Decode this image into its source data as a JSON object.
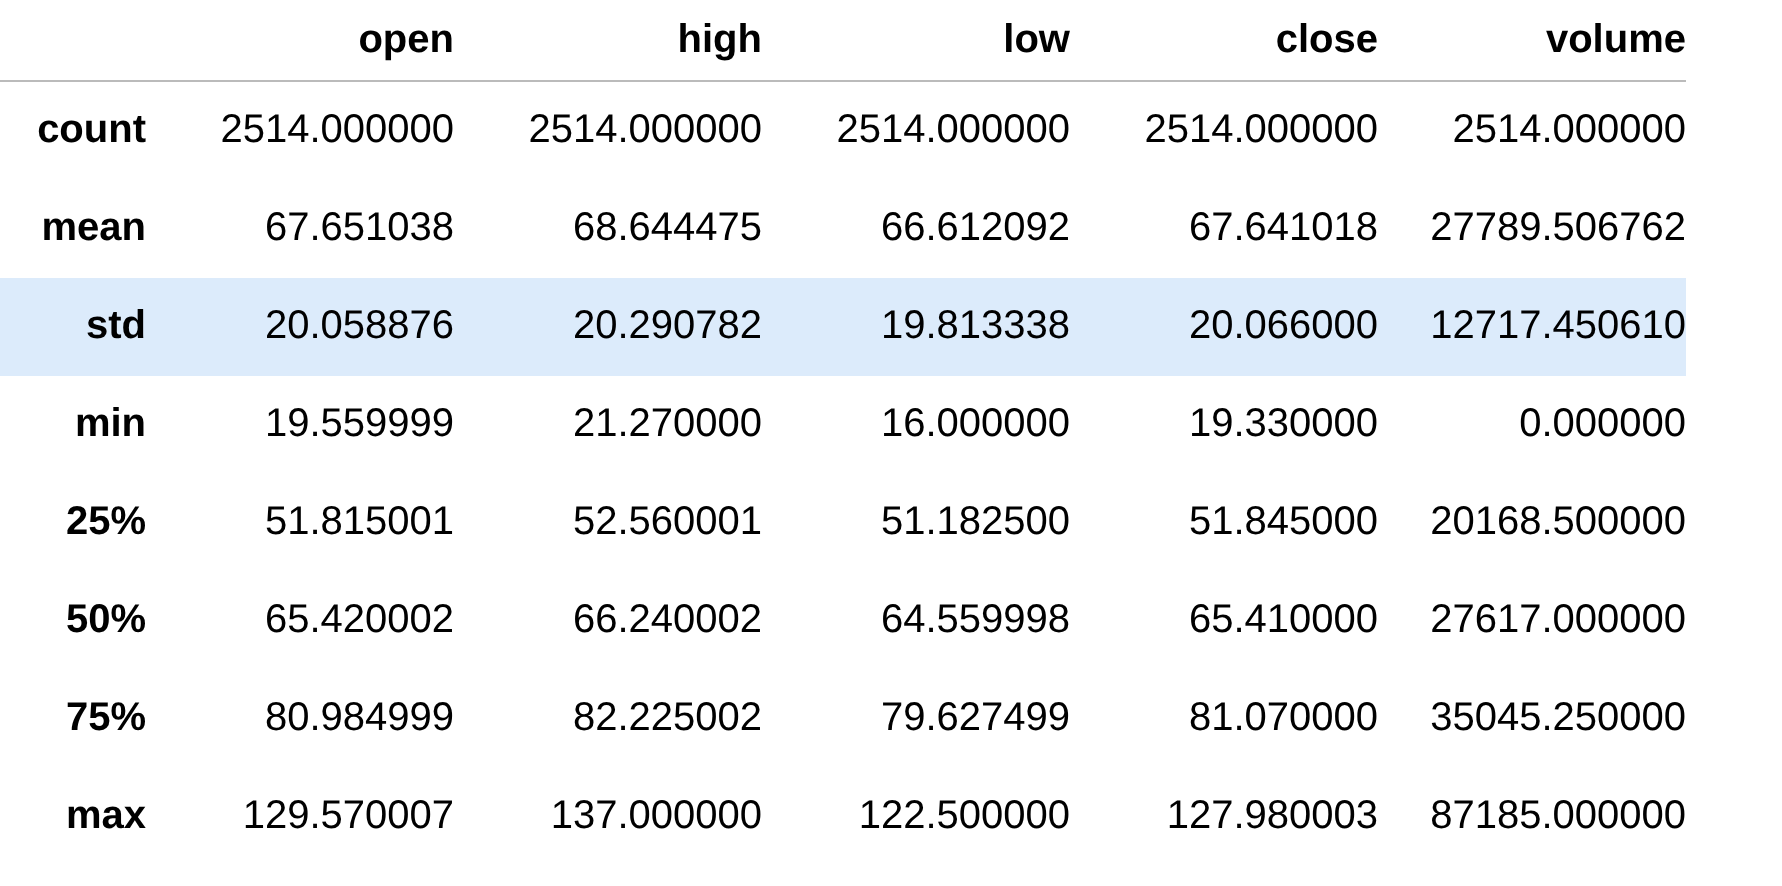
{
  "table": {
    "columns": [
      "open",
      "high",
      "low",
      "close",
      "volume"
    ],
    "rows": [
      {
        "label": "count",
        "selected": false,
        "cells": [
          "2514.000000",
          "2514.000000",
          "2514.000000",
          "2514.000000",
          "2514.000000"
        ]
      },
      {
        "label": "mean",
        "selected": false,
        "cells": [
          "67.651038",
          "68.644475",
          "66.612092",
          "67.641018",
          "27789.506762"
        ]
      },
      {
        "label": "std",
        "selected": true,
        "cells": [
          "20.058876",
          "20.290782",
          "19.813338",
          "20.066000",
          "12717.450610"
        ]
      },
      {
        "label": "min",
        "selected": false,
        "cells": [
          "19.559999",
          "21.270000",
          "16.000000",
          "19.330000",
          "0.000000"
        ]
      },
      {
        "label": "25%",
        "selected": false,
        "cells": [
          "51.815001",
          "52.560001",
          "51.182500",
          "51.845000",
          "20168.500000"
        ]
      },
      {
        "label": "50%",
        "selected": false,
        "cells": [
          "65.420002",
          "66.240002",
          "64.559998",
          "65.410000",
          "27617.000000"
        ]
      },
      {
        "label": "75%",
        "selected": false,
        "cells": [
          "80.984999",
          "82.225002",
          "79.627499",
          "81.070000",
          "35045.250000"
        ]
      },
      {
        "label": "max",
        "selected": false,
        "cells": [
          "129.570007",
          "137.000000",
          "122.500000",
          "127.980003",
          "87185.000000"
        ]
      }
    ]
  }
}
